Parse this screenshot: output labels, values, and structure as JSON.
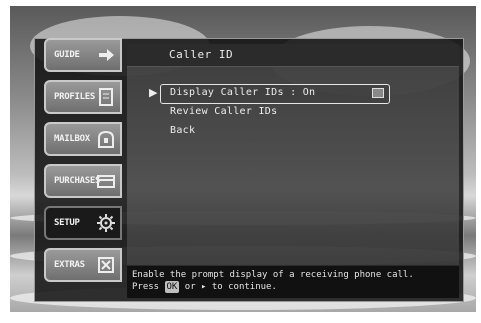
{
  "screen": {
    "title": "Caller ID"
  },
  "tabs": [
    {
      "label": "GUIDE",
      "icon": "arrow-right-icon",
      "active": false
    },
    {
      "label": "PROFILES",
      "icon": "document-icon",
      "active": false
    },
    {
      "label": "MAILBOX",
      "icon": "mailbox-icon",
      "active": false
    },
    {
      "label": "PURCHASES",
      "icon": "purchases-icon",
      "active": false
    },
    {
      "label": "SETUP",
      "icon": "setup-icon",
      "active": true
    },
    {
      "label": "EXTRAS",
      "icon": "extras-icon",
      "active": false
    }
  ],
  "menu": {
    "items": [
      {
        "label": "Display Caller IDs : On",
        "selected": true
      },
      {
        "label": "Review Caller IDs",
        "selected": false
      },
      {
        "label": "Back",
        "selected": false
      }
    ]
  },
  "hint": {
    "line1": "Enable the prompt display of a receiving phone call.",
    "line2_prefix": "Press",
    "ok_key": "OK",
    "line2_suffix": "or ▸ to continue."
  }
}
